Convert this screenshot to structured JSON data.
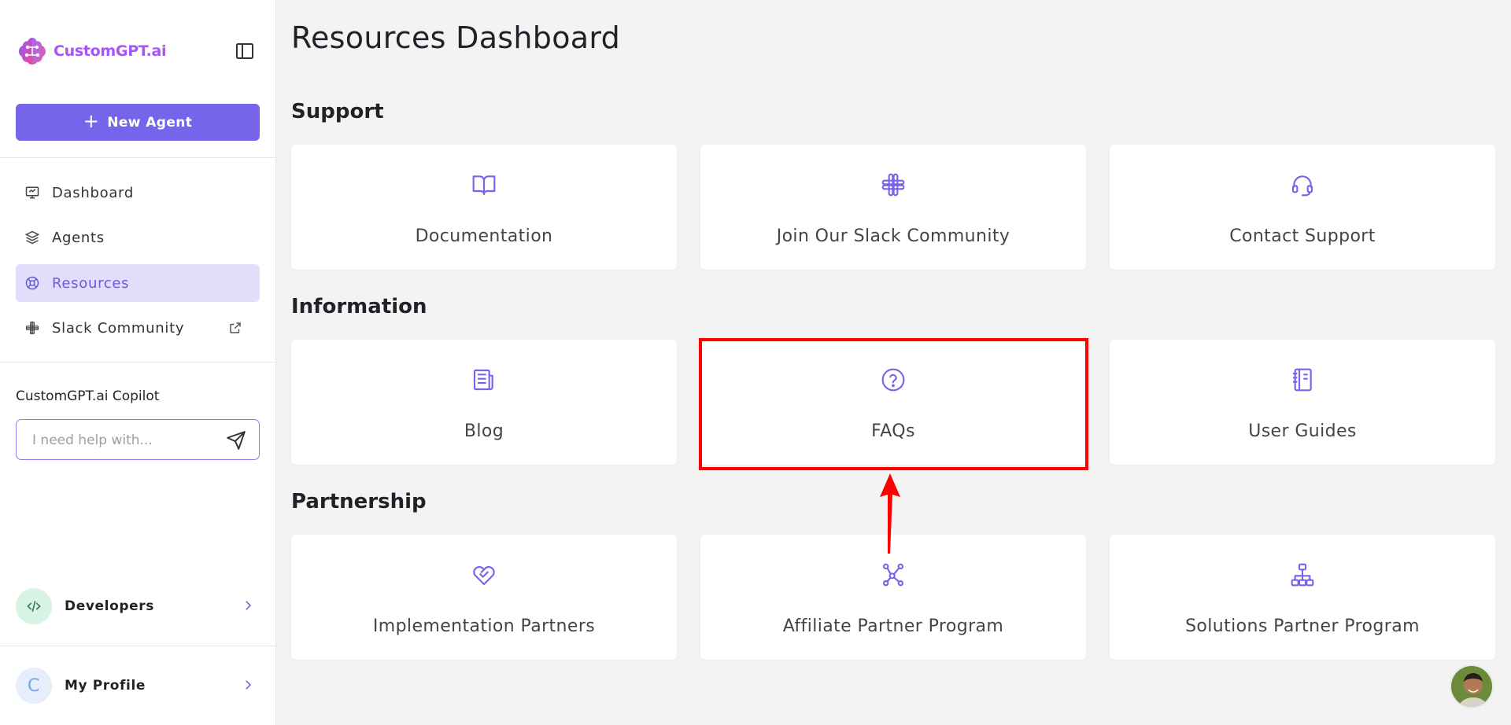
{
  "app": {
    "brand_name": "CustomGPT.ai",
    "brand_color": "#a855f7",
    "accent": "#7664ea"
  },
  "sidebar": {
    "new_agent_label": "New Agent",
    "nav": [
      {
        "label": "Dashboard",
        "icon": "monitor-icon",
        "active": false
      },
      {
        "label": "Agents",
        "icon": "layers-icon",
        "active": false
      },
      {
        "label": "Resources",
        "icon": "lifebuoy-icon",
        "active": true
      },
      {
        "label": "Slack Community",
        "icon": "slack-icon",
        "active": false,
        "external": true
      }
    ],
    "copilot": {
      "title": "CustomGPT.ai Copilot",
      "placeholder": "I need help with..."
    },
    "developers_label": "Developers",
    "profile_label": "My Profile",
    "profile_initial": "C"
  },
  "main": {
    "title": "Resources Dashboard",
    "sections": [
      {
        "title": "Support",
        "cards": [
          {
            "label": "Documentation",
            "icon": "book-open-icon"
          },
          {
            "label": "Join Our Slack Community",
            "icon": "slack-icon"
          },
          {
            "label": "Contact Support",
            "icon": "headset-icon"
          }
        ]
      },
      {
        "title": "Information",
        "cards": [
          {
            "label": "Blog",
            "icon": "newspaper-icon"
          },
          {
            "label": "FAQs",
            "icon": "question-circle-icon",
            "highlighted": true
          },
          {
            "label": "User Guides",
            "icon": "notebook-icon"
          }
        ]
      },
      {
        "title": "Partnership",
        "cards": [
          {
            "label": "Implementation Partners",
            "icon": "handshake-heart-icon"
          },
          {
            "label": "Affiliate Partner Program",
            "icon": "share-nodes-icon"
          },
          {
            "label": "Solutions Partner Program",
            "icon": "hierarchy-icon"
          }
        ]
      }
    ]
  },
  "annotation": {
    "highlight_color": "#ff0000",
    "highlight_target": "FAQs"
  }
}
